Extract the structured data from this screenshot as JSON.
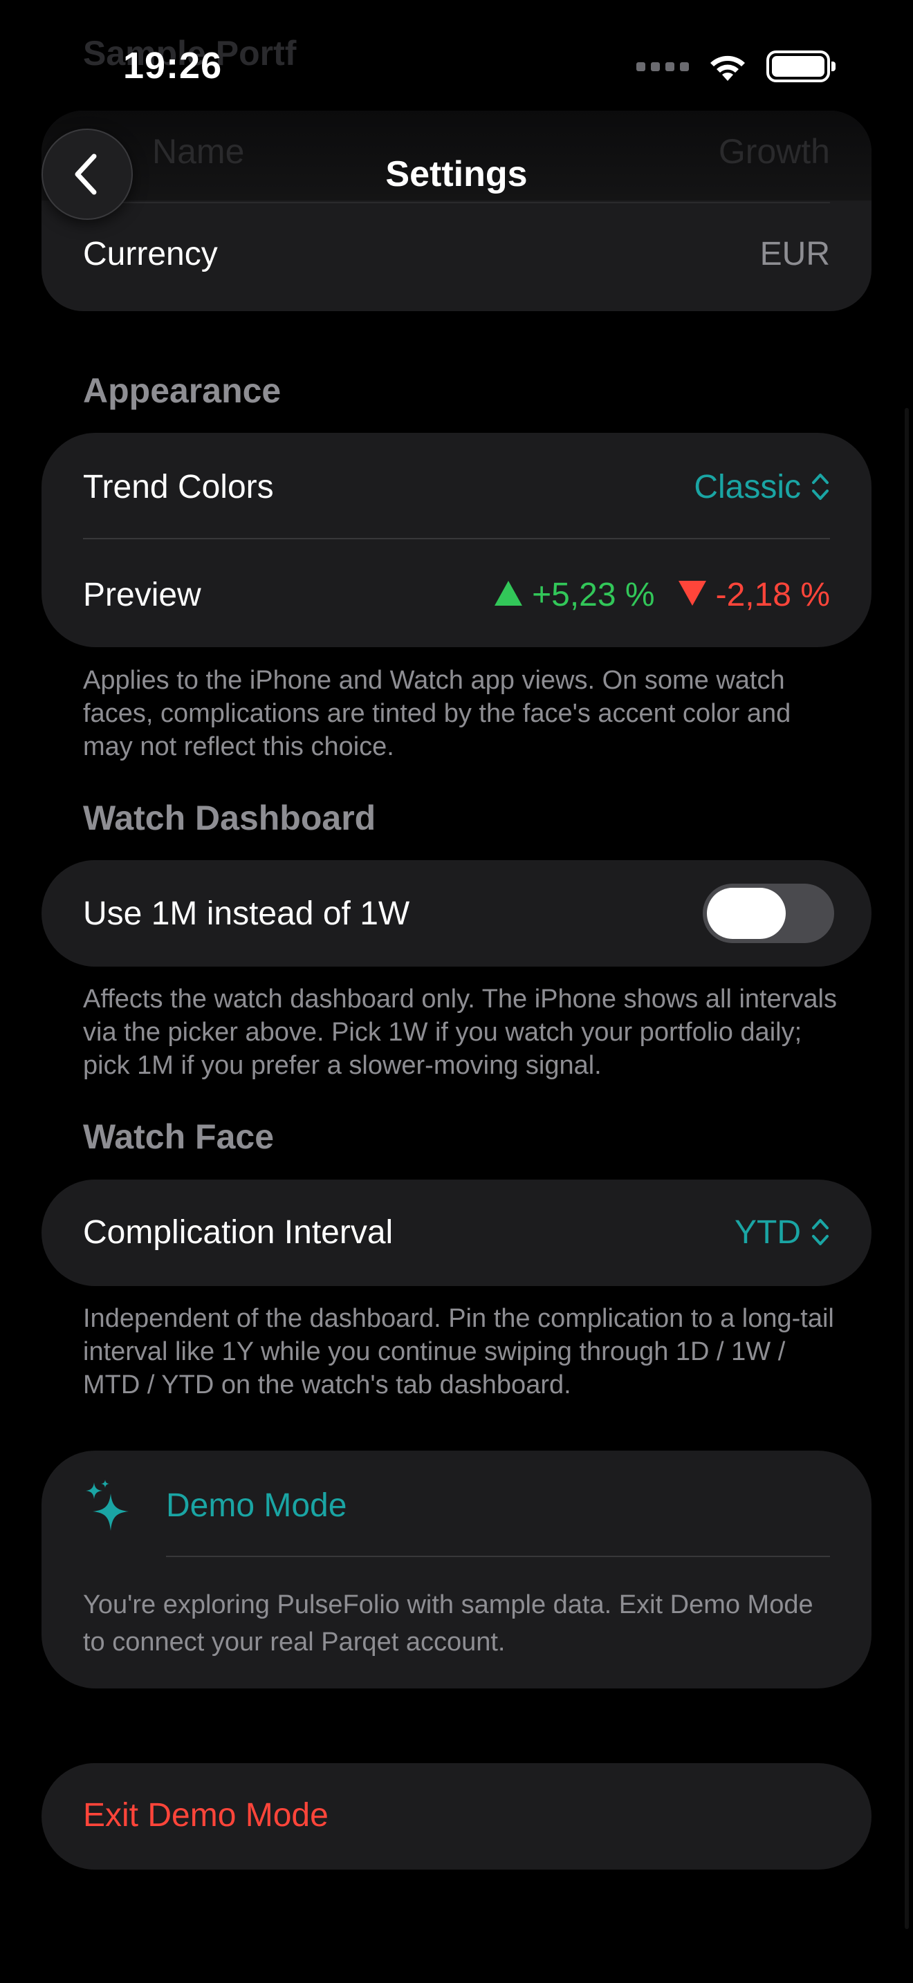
{
  "status_bar": {
    "time": "19:26"
  },
  "behind_nav": {
    "section_title": "Sample Portf",
    "row_left": "Name",
    "row_right": "Growth"
  },
  "nav": {
    "title": "Settings",
    "back_icon": "chevron-left-icon"
  },
  "general": {
    "currency_label": "Currency",
    "currency_value": "EUR"
  },
  "appearance": {
    "header": "Appearance",
    "trend_colors_label": "Trend Colors",
    "trend_colors_value": "Classic",
    "preview_label": "Preview",
    "preview_up": "+5,23 %",
    "preview_down": "-2,18 %",
    "footnote": "Applies to the iPhone and Watch app views. On some watch faces, complications are tinted by the face's accent color and may not reflect this choice."
  },
  "watch_dashboard": {
    "header": "Watch Dashboard",
    "toggle_label": "Use 1M instead of 1W",
    "toggle_on": false,
    "footnote": "Affects the watch dashboard only. The iPhone shows all intervals via the picker above. Pick 1W if you watch your portfolio daily; pick 1M if you prefer a slower-moving signal."
  },
  "watch_face": {
    "header": "Watch Face",
    "interval_label": "Complication Interval",
    "interval_value": "YTD",
    "footnote": "Independent of the dashboard. Pin the complication to a long-tail interval like 1Y while you continue swiping through 1D / 1W / MTD / YTD on the watch's tab dashboard."
  },
  "demo": {
    "title": "Demo Mode",
    "icon": "sparkles-icon",
    "description": "You're exploring PulseFolio with sample data. Exit Demo Mode to connect your real Parqet account.",
    "exit_label": "Exit Demo Mode"
  },
  "colors": {
    "accent": "#1aa5a4",
    "positive": "#32c759",
    "negative": "#ff453a",
    "card": "#1c1c1e",
    "secondary_text": "#8e8e93"
  }
}
